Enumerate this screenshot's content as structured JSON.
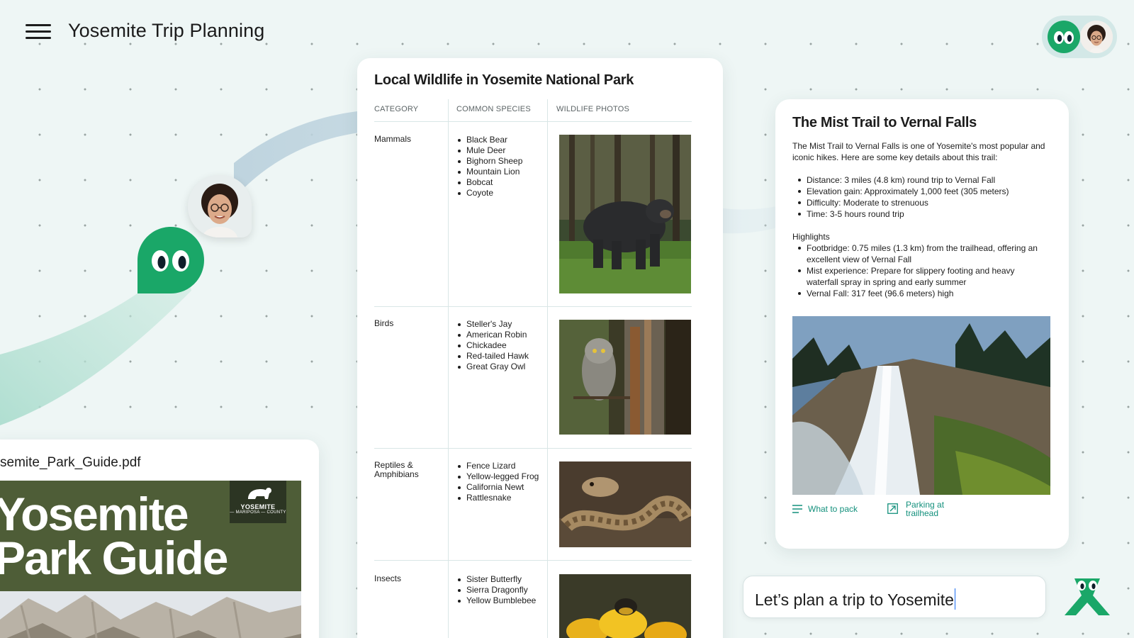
{
  "app": {
    "title": "Yosemite Trip Planning"
  },
  "colors": {
    "accent_green": "#1aa768",
    "link_teal": "#13907c",
    "background": "#eef6f5",
    "pdf_cover": "#4e5d37"
  },
  "icons": [
    "menu-icon",
    "bot-avatar-icon",
    "user-avatar-icon",
    "list-icon",
    "external-link-icon",
    "mascot-icon"
  ],
  "wildlife": {
    "title": "Local Wildlife in Yosemite National Park",
    "columns": [
      "CATEGORY",
      "COMMON SPECIES",
      "WILDLIFE PHOTOS"
    ],
    "rows": [
      {
        "category": "Mammals",
        "species": [
          "Black Bear",
          "Mule Deer",
          "Bighorn Sheep",
          "Mountain Lion",
          "Bobcat",
          "Coyote"
        ],
        "photo": "black-bear"
      },
      {
        "category": "Birds",
        "species": [
          "Steller's Jay",
          "American Robin",
          "Chickadee",
          "Red-tailed Hawk",
          "Great Gray Owl"
        ],
        "photo": "great-gray-owl"
      },
      {
        "category": "Reptiles & Amphibians",
        "species": [
          "Fence Lizard",
          "Yellow-legged Frog",
          "California Newt",
          "Rattlesnake"
        ],
        "photo": "rattlesnake"
      },
      {
        "category": "Insects",
        "species": [
          "Sister Butterfly",
          "Sierra Dragonfly",
          "Yellow Bumblebee"
        ],
        "photo": "bumblebee"
      }
    ]
  },
  "mist_trail": {
    "title": "The Mist Trail to Vernal Falls",
    "intro": "The Mist Trail to Vernal Falls is one of Yosemite's most popular and iconic hikes. Here are some key details about this trail:",
    "details": [
      "Distance: 3 miles (4.8 km) round trip to Vernal Fall",
      "Elevation gain: Approximately 1,000 feet (305 meters)",
      "Difficulty: Moderate to strenuous",
      "Time: 3-5 hours round trip"
    ],
    "highlights_label": "Highlights",
    "highlights": [
      "Footbridge: 0.75 miles (1.3 km) from the trailhead, offering an excellent view of Vernal Fall",
      "Mist experience: Prepare for slippery footing and heavy waterfall spray in spring and early summer",
      "Vernal Fall: 317 feet (96.6 meters) high"
    ],
    "links": [
      {
        "label": "What to pack",
        "icon": "list-icon"
      },
      {
        "label": "Parking at trailhead",
        "icon": "external-link-icon"
      }
    ]
  },
  "pdf": {
    "filename": "semite_Park_Guide.pdf",
    "cover_title_line1": "Yosemite",
    "cover_title_line2": "Park Guide",
    "badge_line1": "YOSEMITE",
    "badge_line2": "— MARIPOSA — COUNTY"
  },
  "chat": {
    "input_value": "Let’s plan a trip to Yosemite"
  }
}
